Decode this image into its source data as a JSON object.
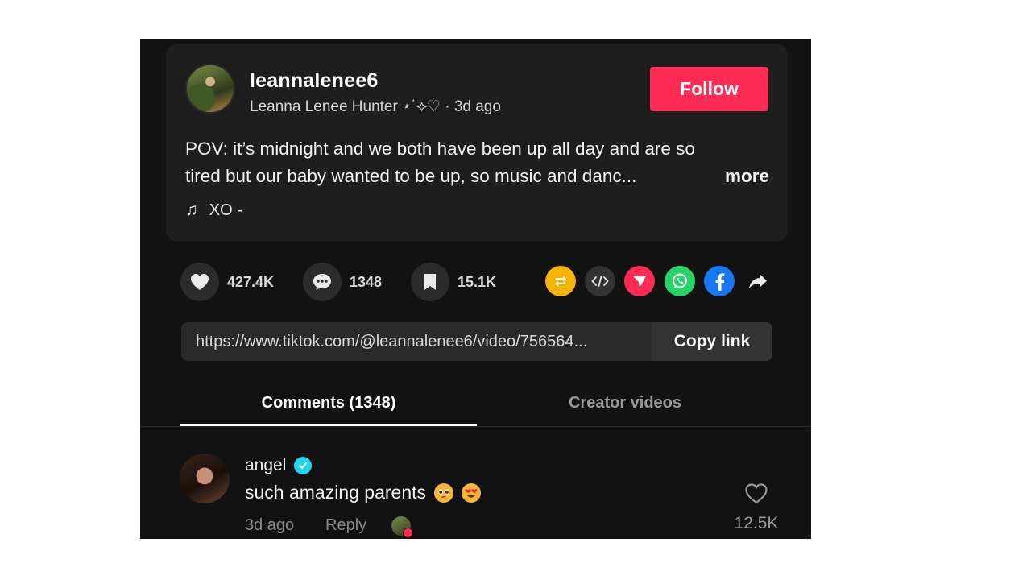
{
  "post": {
    "username": "leannalenee6",
    "display_name": "Leanna Lenee Hunter ⋆˙⟡♡",
    "separator": "·",
    "posted": "3d ago",
    "follow_label": "Follow",
    "caption_line1": "POV: it’s midnight and we both have been up all day and are so",
    "caption_line2": "tired but our baby wanted to be up, so music and danc...",
    "more_label": "more",
    "music_icon": "♫",
    "music_title": "XO -"
  },
  "stats": {
    "likes": "427.4K",
    "comments": "1348",
    "saves": "15.1K"
  },
  "share": {
    "icons": [
      "repost-icon",
      "embed-icon",
      "send-icon",
      "whatsapp-icon",
      "facebook-icon",
      "share-arrow-icon"
    ]
  },
  "link": {
    "url": "https://www.tiktok.com/@leannalenee6/video/756564...",
    "copy_label": "Copy link"
  },
  "tabs": {
    "comments": "Comments (1348)",
    "creator_videos": "Creator videos"
  },
  "comment": {
    "author": "angel",
    "text": "such amazing parents",
    "time": "3d ago",
    "reply_label": "Reply",
    "like_count": "12.5K"
  },
  "colors": {
    "accent": "#fe2c55",
    "background": "#121212",
    "card": "#1e1e1e",
    "verified": "#20d5ec"
  }
}
